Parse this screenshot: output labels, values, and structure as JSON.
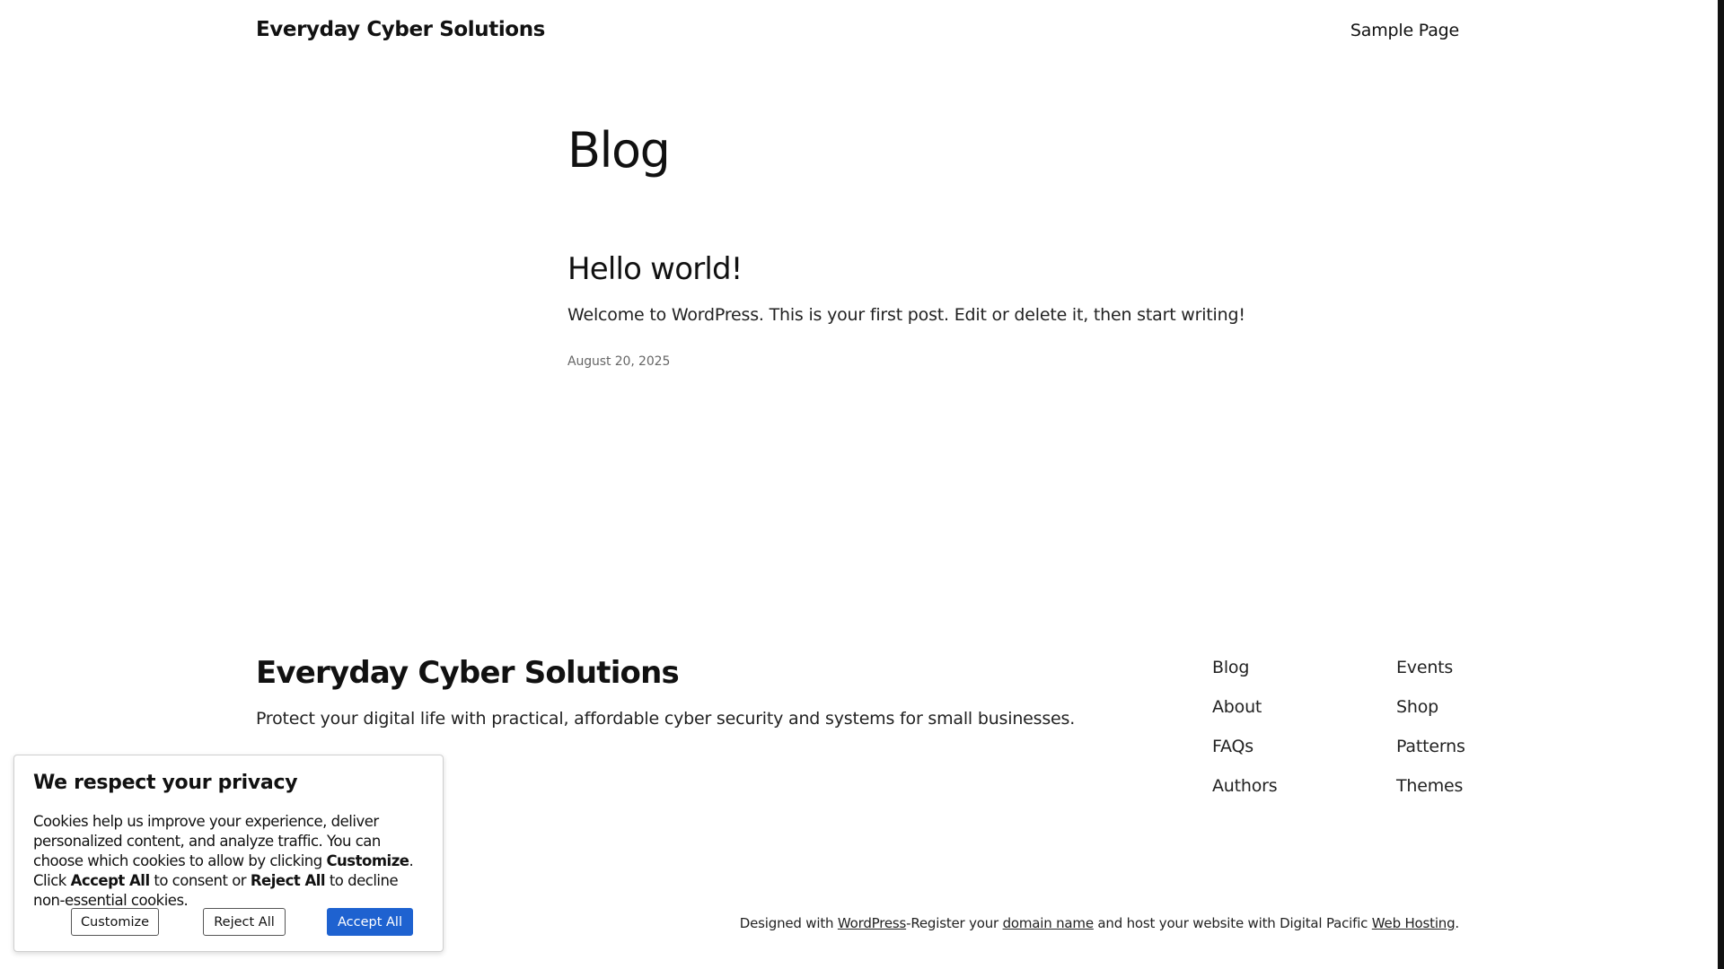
{
  "header": {
    "site_title": "Everyday Cyber Solutions",
    "nav": [
      "Sample Page"
    ]
  },
  "main": {
    "page_title": "Blog",
    "posts": [
      {
        "title": "Hello world!",
        "excerpt": "Welcome to WordPress. This is your first post. Edit or delete it, then start writing!",
        "date": "August 20, 2025"
      }
    ]
  },
  "footer": {
    "site_title": "Everyday Cyber Solutions",
    "tagline": "Protect your digital life with practical, affordable cyber security and systems for small businesses.",
    "nav_col1": [
      "Blog",
      "About",
      "FAQs",
      "Authors"
    ],
    "nav_col2": [
      "Events",
      "Shop",
      "Patterns",
      "Themes"
    ],
    "credits": {
      "prefix": "Designed with ",
      "wordpress_link": "WordPress",
      "middle1": "-Register your ",
      "domain_link": "domain name",
      "middle2": " and host your website with Digital Pacific ",
      "hosting_link": "Web Hosting",
      "suffix": "."
    }
  },
  "cookie_banner": {
    "heading": "We respect your privacy",
    "body_part1": "Cookies help us improve your experience, deliver personalized content, and analyze traffic. You can choose which cookies to allow by clicking ",
    "body_bold1": "Customize",
    "body_part2": ". Click ",
    "body_bold2": "Accept All",
    "body_part3": " to consent or ",
    "body_bold3": "Reject All",
    "body_part4": " to decline non-essential cookies.",
    "buttons": {
      "customize": "Customize",
      "reject": "Reject All",
      "accept": "Accept All"
    },
    "accent_color": "#1e62d0"
  }
}
